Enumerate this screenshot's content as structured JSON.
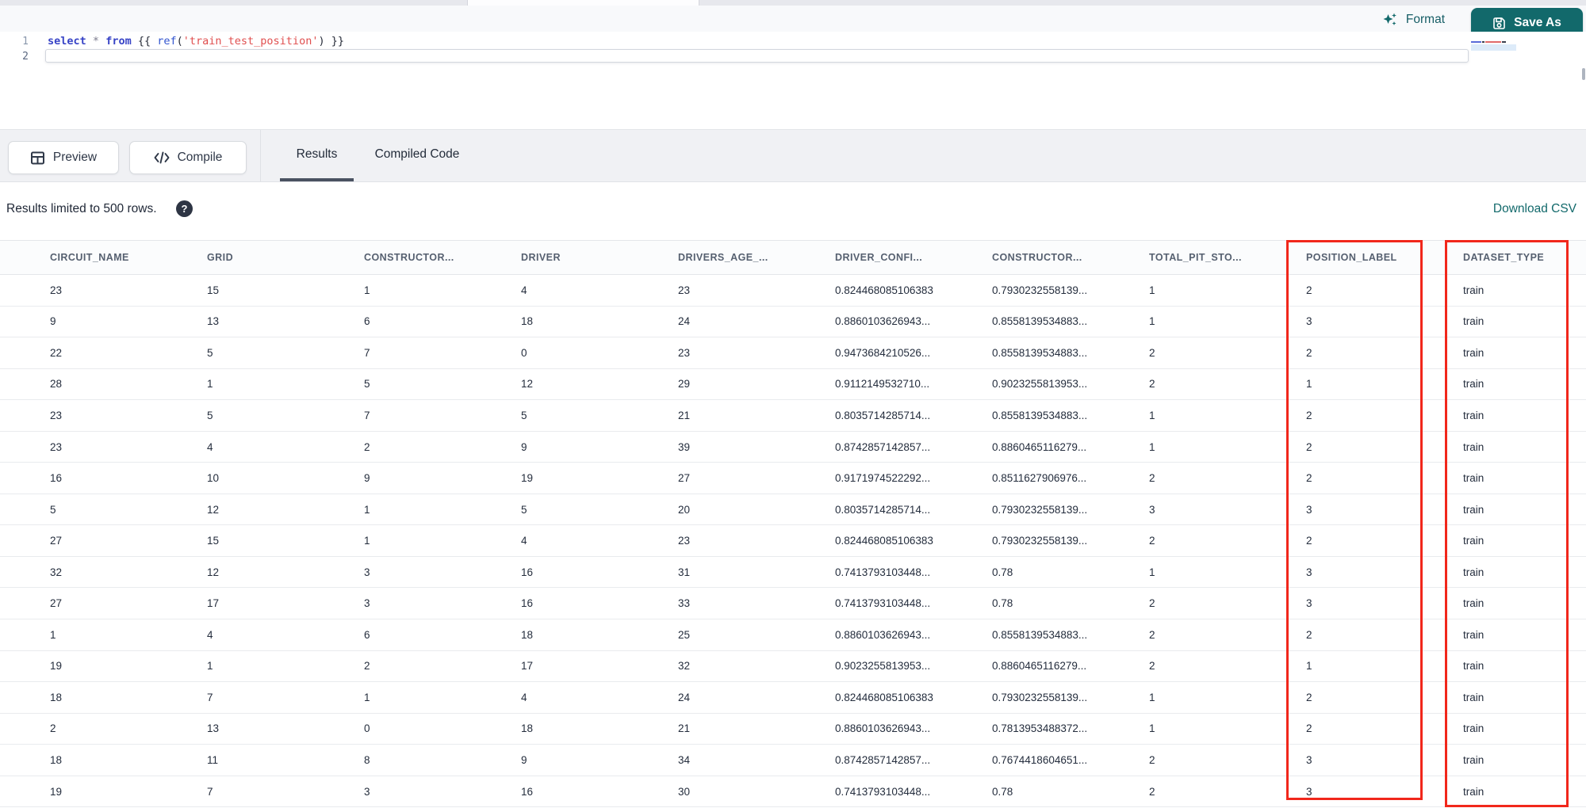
{
  "colors": {
    "accent_teal": "#12696b",
    "annotation_red": "#f1271b",
    "keyword_blue": "#3743c6",
    "string_red": "#e04f4f"
  },
  "toolbar": {
    "format_label": "Format",
    "save_as_label": "Save As"
  },
  "editor": {
    "line_numbers": [
      "1",
      "2"
    ],
    "code_line_1": {
      "tokens": [
        {
          "text": "select",
          "type": "keyword"
        },
        {
          "text": " ",
          "type": "plain"
        },
        {
          "text": "*",
          "type": "operator"
        },
        {
          "text": " ",
          "type": "plain"
        },
        {
          "text": "from",
          "type": "keyword"
        },
        {
          "text": " {{ ",
          "type": "plain"
        },
        {
          "text": "ref",
          "type": "function"
        },
        {
          "text": "(",
          "type": "plain"
        },
        {
          "text": "'train_test_position'",
          "type": "string"
        },
        {
          "text": ")",
          "type": "plain"
        },
        {
          "text": " }}",
          "type": "plain"
        }
      ]
    }
  },
  "action_bar": {
    "preview_label": "Preview",
    "compile_label": "Compile",
    "tabs": [
      {
        "label": "Results",
        "active": true
      },
      {
        "label": "Compiled Code",
        "active": false
      }
    ]
  },
  "results_bar": {
    "limit_text": "Results limited to 500 rows.",
    "help_icon": "?",
    "download_label": "Download CSV"
  },
  "table": {
    "columns": [
      "CIRCUIT_NAME",
      "GRID",
      "CONSTRUCTOR...",
      "DRIVER",
      "DRIVERS_AGE_...",
      "DRIVER_CONFI...",
      "CONSTRUCTOR...",
      "TOTAL_PIT_STO...",
      "POSITION_LABEL",
      "DATASET_TYPE"
    ],
    "highlighted_columns": [
      "POSITION_LABEL",
      "DATASET_TYPE"
    ],
    "rows": [
      [
        "23",
        "15",
        "1",
        "4",
        "23",
        "0.824468085106383",
        "0.7930232558139...",
        "1",
        "2",
        "train"
      ],
      [
        "9",
        "13",
        "6",
        "18",
        "24",
        "0.8860103626943...",
        "0.8558139534883...",
        "1",
        "3",
        "train"
      ],
      [
        "22",
        "5",
        "7",
        "0",
        "23",
        "0.9473684210526...",
        "0.8558139534883...",
        "2",
        "2",
        "train"
      ],
      [
        "28",
        "1",
        "5",
        "12",
        "29",
        "0.9112149532710...",
        "0.9023255813953...",
        "2",
        "1",
        "train"
      ],
      [
        "23",
        "5",
        "7",
        "5",
        "21",
        "0.8035714285714...",
        "0.8558139534883...",
        "1",
        "2",
        "train"
      ],
      [
        "23",
        "4",
        "2",
        "9",
        "39",
        "0.8742857142857...",
        "0.8860465116279...",
        "1",
        "2",
        "train"
      ],
      [
        "16",
        "10",
        "9",
        "19",
        "27",
        "0.9171974522292...",
        "0.8511627906976...",
        "2",
        "2",
        "train"
      ],
      [
        "5",
        "12",
        "1",
        "5",
        "20",
        "0.8035714285714...",
        "0.7930232558139...",
        "3",
        "3",
        "train"
      ],
      [
        "27",
        "15",
        "1",
        "4",
        "23",
        "0.824468085106383",
        "0.7930232558139...",
        "2",
        "2",
        "train"
      ],
      [
        "32",
        "12",
        "3",
        "16",
        "31",
        "0.7413793103448...",
        "0.78",
        "1",
        "3",
        "train"
      ],
      [
        "27",
        "17",
        "3",
        "16",
        "33",
        "0.7413793103448...",
        "0.78",
        "2",
        "3",
        "train"
      ],
      [
        "1",
        "4",
        "6",
        "18",
        "25",
        "0.8860103626943...",
        "0.8558139534883...",
        "2",
        "2",
        "train"
      ],
      [
        "19",
        "1",
        "2",
        "17",
        "32",
        "0.9023255813953...",
        "0.8860465116279...",
        "2",
        "1",
        "train"
      ],
      [
        "18",
        "7",
        "1",
        "4",
        "24",
        "0.824468085106383",
        "0.7930232558139...",
        "1",
        "2",
        "train"
      ],
      [
        "2",
        "13",
        "0",
        "18",
        "21",
        "0.8860103626943...",
        "0.7813953488372...",
        "1",
        "2",
        "train"
      ],
      [
        "18",
        "11",
        "8",
        "9",
        "34",
        "0.8742857142857...",
        "0.7674418604651...",
        "2",
        "3",
        "train"
      ],
      [
        "19",
        "7",
        "3",
        "16",
        "30",
        "0.7413793103448...",
        "0.78",
        "2",
        "3",
        "train"
      ]
    ]
  }
}
